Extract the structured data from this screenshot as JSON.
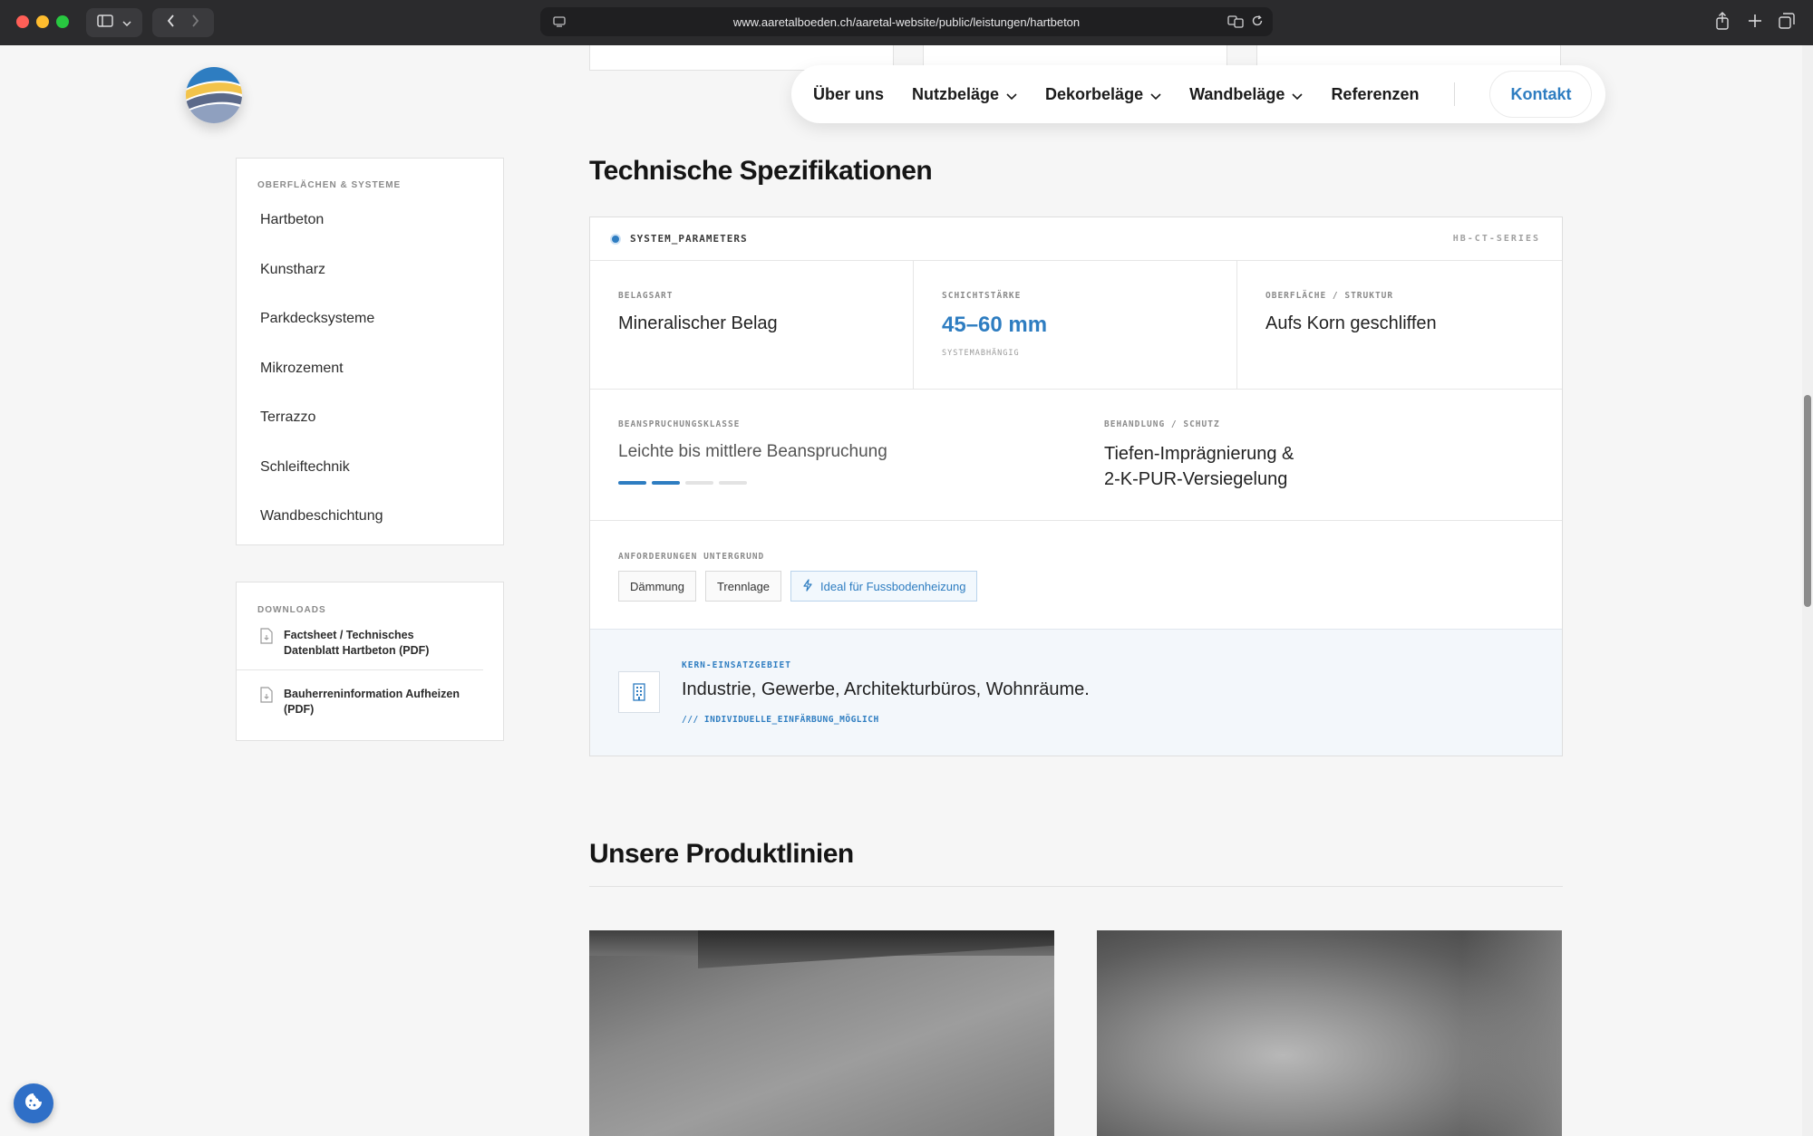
{
  "browser": {
    "url": "www.aaretalboeden.ch/aaretal-website/public/leistungen/hartbeton"
  },
  "nav": {
    "items": [
      "Über uns",
      "Nutzbeläge",
      "Dekorbeläge",
      "Wandbeläge",
      "Referenzen"
    ],
    "contact": "Kontakt"
  },
  "sidebar": {
    "heading": "OBERFLÄCHEN & SYSTEME",
    "items": [
      "Hartbeton",
      "Kunstharz",
      "Parkdecksysteme",
      "Mikrozement",
      "Terrazzo",
      "Schleiftechnik",
      "Wandbeschichtung"
    ]
  },
  "downloads": {
    "heading": "DOWNLOADS",
    "items": [
      "Factsheet / Technisches Datenblatt Hartbeton (PDF)",
      "Bauherreninformation Aufheizen (PDF)"
    ]
  },
  "spec": {
    "title": "Technische Spezifikationen",
    "header_left": "SYSTEM_PARAMETERS",
    "header_right": "HB-CT-SERIES",
    "belagsart_label": "BELAGSART",
    "belagsart_value": "Mineralischer Belag",
    "schicht_label": "SCHICHTSTÄRKE",
    "schicht_value": "45–60 mm",
    "schicht_note": "SYSTEMABHÄNGIG",
    "oberflaeche_label": "OBERFLÄCHE / STRUKTUR",
    "oberflaeche_value": "Aufs Korn geschliffen",
    "beanspruchung_label": "BEANSPRUCHUNGSKLASSE",
    "beanspruchung_value": "Leichte bis mittlere Beanspruchung",
    "beanspruchung_level": 0.5,
    "behandlung_label": "BEHANDLUNG / SCHUTZ",
    "behandlung_line1": "Tiefen-Imprägnierung &",
    "behandlung_line2": "2-K-PUR-Versiegelung",
    "untergrund_label": "ANFORDERUNGEN UNTERGRUND",
    "tags": [
      "Dämmung",
      "Trennlage",
      "Ideal für Fussbodenheizung"
    ],
    "kern_label": "KERN-EINSATZGEBIET",
    "kern_value": "Industrie, Gewerbe, Architekturbüros, Wohnräume.",
    "kern_note": "/// INDIVIDUELLE_EINFÄRBUNG_MÖGLICH"
  },
  "products": {
    "title": "Unsere Produktlinien"
  },
  "colors": {
    "accent": "#2e7dc1",
    "page_bg": "#f6f6f6"
  }
}
